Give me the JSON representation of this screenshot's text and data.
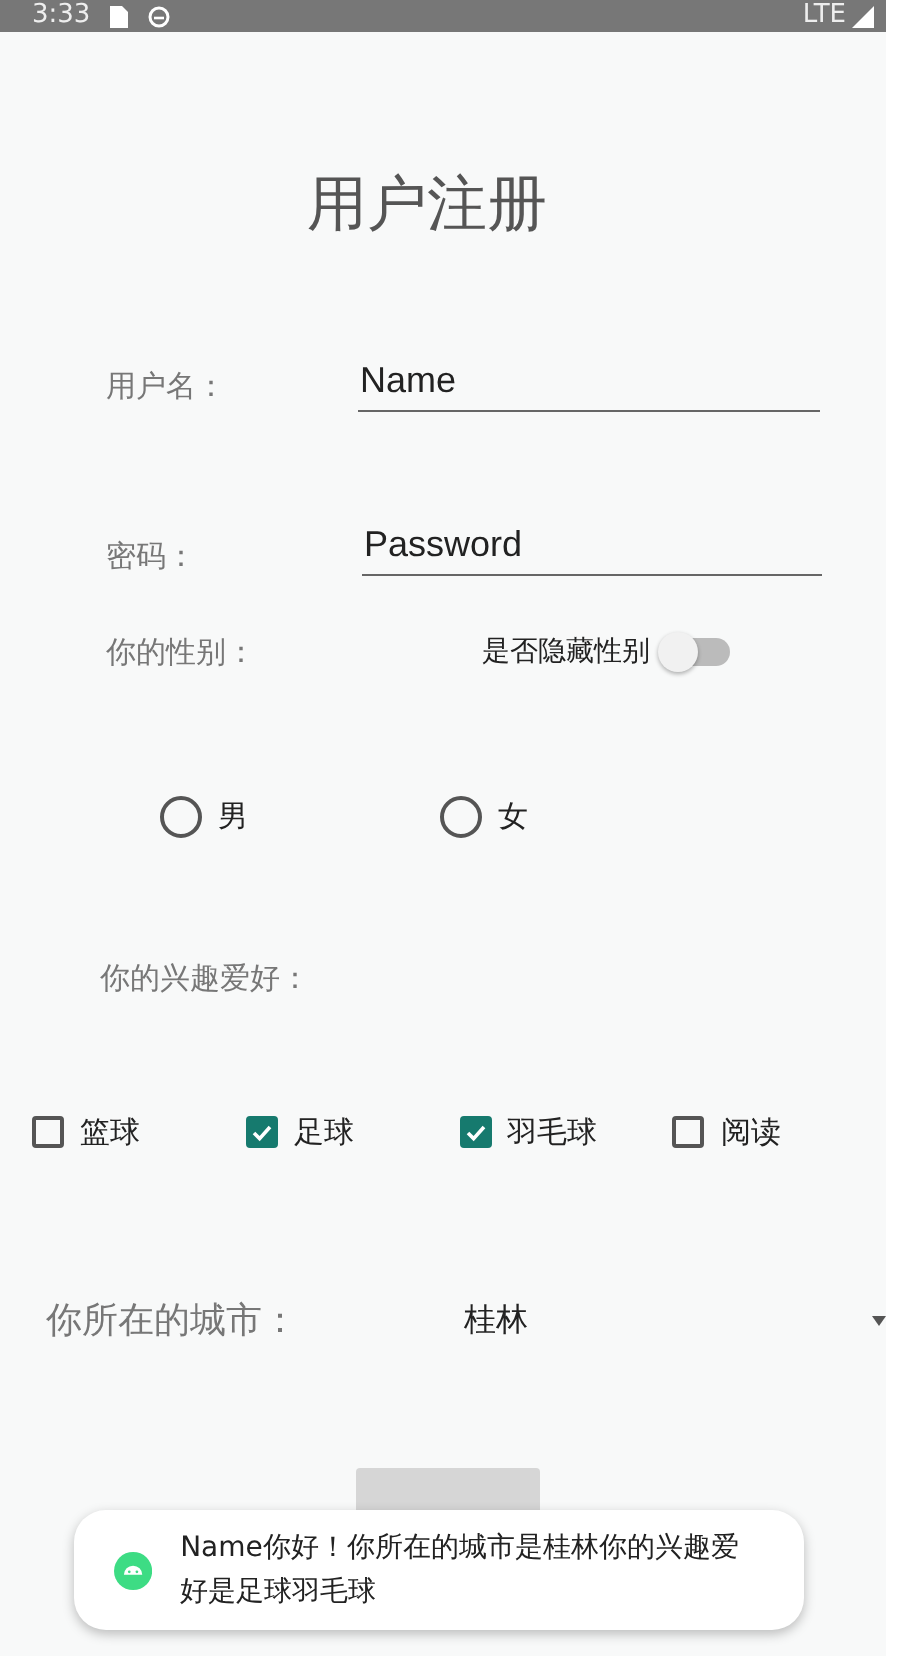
{
  "status_bar": {
    "time": "3:33",
    "network": "LTE"
  },
  "title": "用户注册",
  "fields": [
    {
      "label": "用户名：",
      "value": "Name"
    },
    {
      "label": "密码：",
      "value": "Password"
    }
  ],
  "gender": {
    "label": "你的性别：",
    "hide_switch": {
      "label": "是否隐藏性别",
      "on": false
    },
    "options": [
      {
        "label": "男",
        "selected": false
      },
      {
        "label": "女",
        "selected": false
      }
    ]
  },
  "hobbies": {
    "label": "你的兴趣爱好：",
    "options": [
      {
        "label": "篮球",
        "checked": false
      },
      {
        "label": "足球",
        "checked": true
      },
      {
        "label": "羽毛球",
        "checked": true
      },
      {
        "label": "阅读",
        "checked": false
      }
    ]
  },
  "city": {
    "label": "你所在的城市：",
    "value": "桂林"
  },
  "toast": {
    "text": "Name你好！你所在的城市是桂林你的兴趣爱好是足球羽毛球"
  }
}
